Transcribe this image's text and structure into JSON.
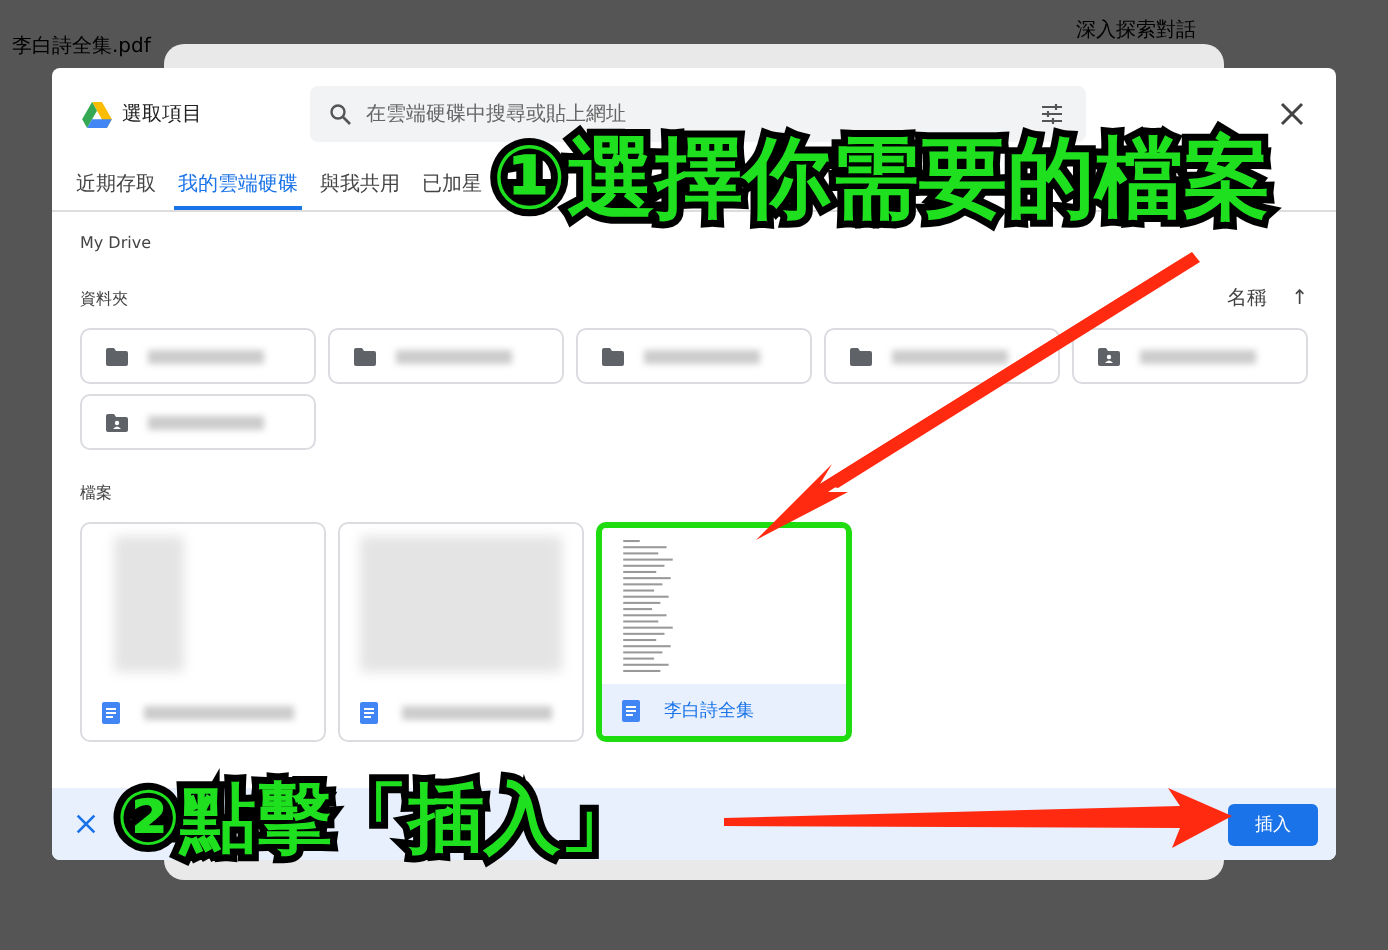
{
  "background": {
    "texts": [
      "李白詩全集.pdf",
      "深入探索對話"
    ]
  },
  "dialog": {
    "title": "選取項目",
    "search": {
      "placeholder": "在雲端硬碟中搜尋或貼上網址"
    },
    "tabs": [
      {
        "label": "近期存取",
        "selected": false
      },
      {
        "label": "我的雲端硬碟",
        "selected": true
      },
      {
        "label": "與我共用",
        "selected": false
      },
      {
        "label": "已加星",
        "selected": false
      }
    ],
    "breadcrumb": "My Drive",
    "folders_heading": "資料夾",
    "sort": {
      "label": "名稱",
      "arrow": "↑"
    },
    "folders": [
      {
        "kind": "folder"
      },
      {
        "kind": "folder"
      },
      {
        "kind": "folder"
      },
      {
        "kind": "folder"
      },
      {
        "kind": "shared"
      },
      {
        "kind": "shared"
      }
    ],
    "files_heading": "檔案",
    "files": [
      {
        "selected": false
      },
      {
        "selected": false
      },
      {
        "selected": true,
        "name": "李白詩全集"
      }
    ],
    "insert_button": "插入"
  },
  "annotations": [
    {
      "text": "①選擇你需要的檔案"
    },
    {
      "text": "②點擊「插入」"
    }
  ]
}
